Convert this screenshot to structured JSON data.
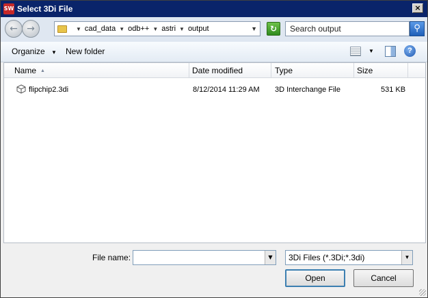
{
  "window": {
    "title": "Select 3Di File",
    "app_icon": "app-logo-icon",
    "close_glyph": "×"
  },
  "address": {
    "breadcrumb": [
      "cad_data",
      "odb++",
      "astri",
      "output"
    ],
    "search_placeholder": "Search output"
  },
  "toolbar": {
    "organize_label": "Organize",
    "new_folder_label": "New folder"
  },
  "columns": {
    "name": "Name",
    "date_modified": "Date modified",
    "type": "Type",
    "size": "Size"
  },
  "files": [
    {
      "name": "flipchip2.3di",
      "date_modified": "8/12/2014 11:29 AM",
      "type": "3D Interchange File",
      "size": "531 KB",
      "icon": "cube-icon"
    }
  ],
  "footer": {
    "file_name_label": "File name:",
    "file_name_value": "",
    "filter_value": "3Di Files (*.3Di;*.3di)",
    "open_label": "Open",
    "cancel_label": "Cancel"
  },
  "colors": {
    "title_bar": "#0a246a",
    "address_bar_bg": "#dfe7f1",
    "open_button_border": "#3c7fb1"
  }
}
